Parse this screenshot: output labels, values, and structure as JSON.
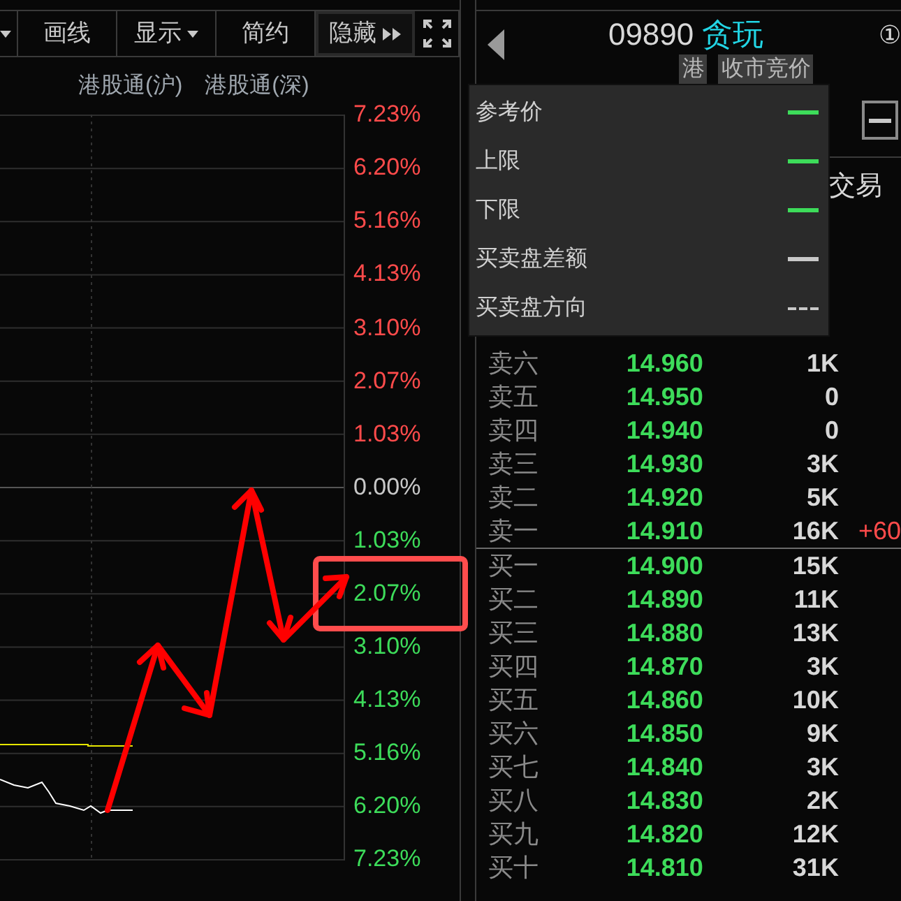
{
  "toolbar": {
    "buttons": [
      {
        "label": "画线",
        "kind": "plain",
        "selected": false
      },
      {
        "label": "显示",
        "kind": "dropdown",
        "selected": false
      },
      {
        "label": "简约",
        "kind": "plain",
        "selected": false
      },
      {
        "label": "隐藏",
        "kind": "expand",
        "selected": true
      }
    ]
  },
  "legend": [
    "港股通(沪)",
    "港股通(深)"
  ],
  "axis_labels": [
    {
      "text": "7.23%",
      "kind": "up"
    },
    {
      "text": "6.20%",
      "kind": "up"
    },
    {
      "text": "5.16%",
      "kind": "up"
    },
    {
      "text": "4.13%",
      "kind": "up"
    },
    {
      "text": "3.10%",
      "kind": "up"
    },
    {
      "text": "2.07%",
      "kind": "up"
    },
    {
      "text": "1.03%",
      "kind": "up"
    },
    {
      "text": "0.00%",
      "kind": "flat"
    },
    {
      "text": "1.03%",
      "kind": "down"
    },
    {
      "text": "2.07%",
      "kind": "down"
    },
    {
      "text": "3.10%",
      "kind": "down"
    },
    {
      "text": "4.13%",
      "kind": "down"
    },
    {
      "text": "5.16%",
      "kind": "down"
    },
    {
      "text": "6.20%",
      "kind": "down"
    },
    {
      "text": "7.23%",
      "kind": "down"
    }
  ],
  "quote": {
    "code": "09890",
    "name": "贪玩",
    "badge": "①",
    "tags": [
      "港",
      "收市竞价"
    ],
    "status": "交易"
  },
  "popup": {
    "items": [
      {
        "label": "参考价",
        "kind": "solid",
        "color": "#3ddc5a"
      },
      {
        "label": "上限",
        "kind": "solid",
        "color": "#3ddc5a"
      },
      {
        "label": "下限",
        "kind": "solid",
        "color": "#3ddc5a"
      },
      {
        "label": "买卖盘差额",
        "kind": "solid",
        "color": "#c8c8c8"
      },
      {
        "label": "买卖盘方向",
        "kind": "dashed",
        "color": "#c8c8c8"
      }
    ]
  },
  "order_book": {
    "asks": [
      {
        "label": "卖六",
        "price": "14.960",
        "volume": "1K"
      },
      {
        "label": "卖五",
        "price": "14.950",
        "volume": "0"
      },
      {
        "label": "卖四",
        "price": "14.940",
        "volume": "0"
      },
      {
        "label": "卖三",
        "price": "14.930",
        "volume": "3K"
      },
      {
        "label": "卖二",
        "price": "14.920",
        "volume": "5K"
      },
      {
        "label": "卖一",
        "price": "14.910",
        "volume": "16K",
        "change": "+60"
      }
    ],
    "bids": [
      {
        "label": "买一",
        "price": "14.900",
        "volume": "15K"
      },
      {
        "label": "买二",
        "price": "14.890",
        "volume": "11K"
      },
      {
        "label": "买三",
        "price": "14.880",
        "volume": "13K"
      },
      {
        "label": "买四",
        "price": "14.870",
        "volume": "3K"
      },
      {
        "label": "买五",
        "price": "14.860",
        "volume": "10K"
      },
      {
        "label": "买六",
        "price": "14.850",
        "volume": "9K"
      },
      {
        "label": "买七",
        "price": "14.840",
        "volume": "3K"
      },
      {
        "label": "买八",
        "price": "14.830",
        "volume": "2K"
      },
      {
        "label": "买九",
        "price": "14.820",
        "volume": "12K"
      },
      {
        "label": "买十",
        "price": "14.810",
        "volume": "31K"
      }
    ]
  }
}
